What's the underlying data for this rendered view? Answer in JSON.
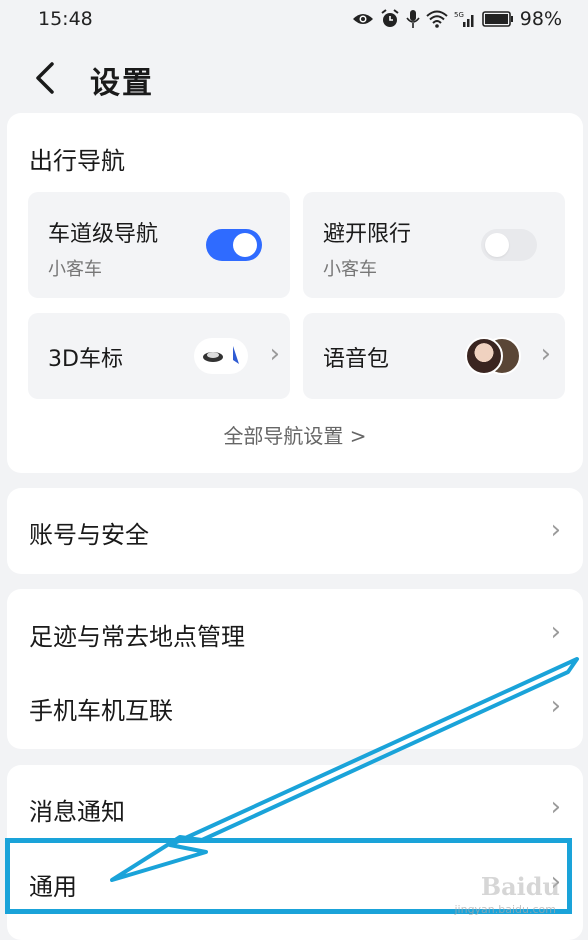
{
  "status_bar": {
    "time": "15:48",
    "battery": "98%"
  },
  "header": {
    "title": "设置"
  },
  "nav_section": {
    "title": "出行导航",
    "tiles": [
      {
        "title": "车道级导航",
        "subtitle": "小客车",
        "toggle": "on"
      },
      {
        "title": "避开限行",
        "subtitle": "小客车",
        "toggle": "off"
      },
      {
        "title": "3D车标"
      },
      {
        "title": "语音包"
      }
    ],
    "all_settings": "全部导航设置 >"
  },
  "rows": {
    "account": "账号与安全",
    "footprint": "足迹与常去地点管理",
    "car_link": "手机车机互联",
    "notify": "消息通知",
    "general": "通用"
  },
  "watermark": {
    "brand": "Baidu",
    "site": "jingyan.baidu.com"
  },
  "colors": {
    "accent": "#2f6bff",
    "annotation": "#1aa3d9"
  }
}
